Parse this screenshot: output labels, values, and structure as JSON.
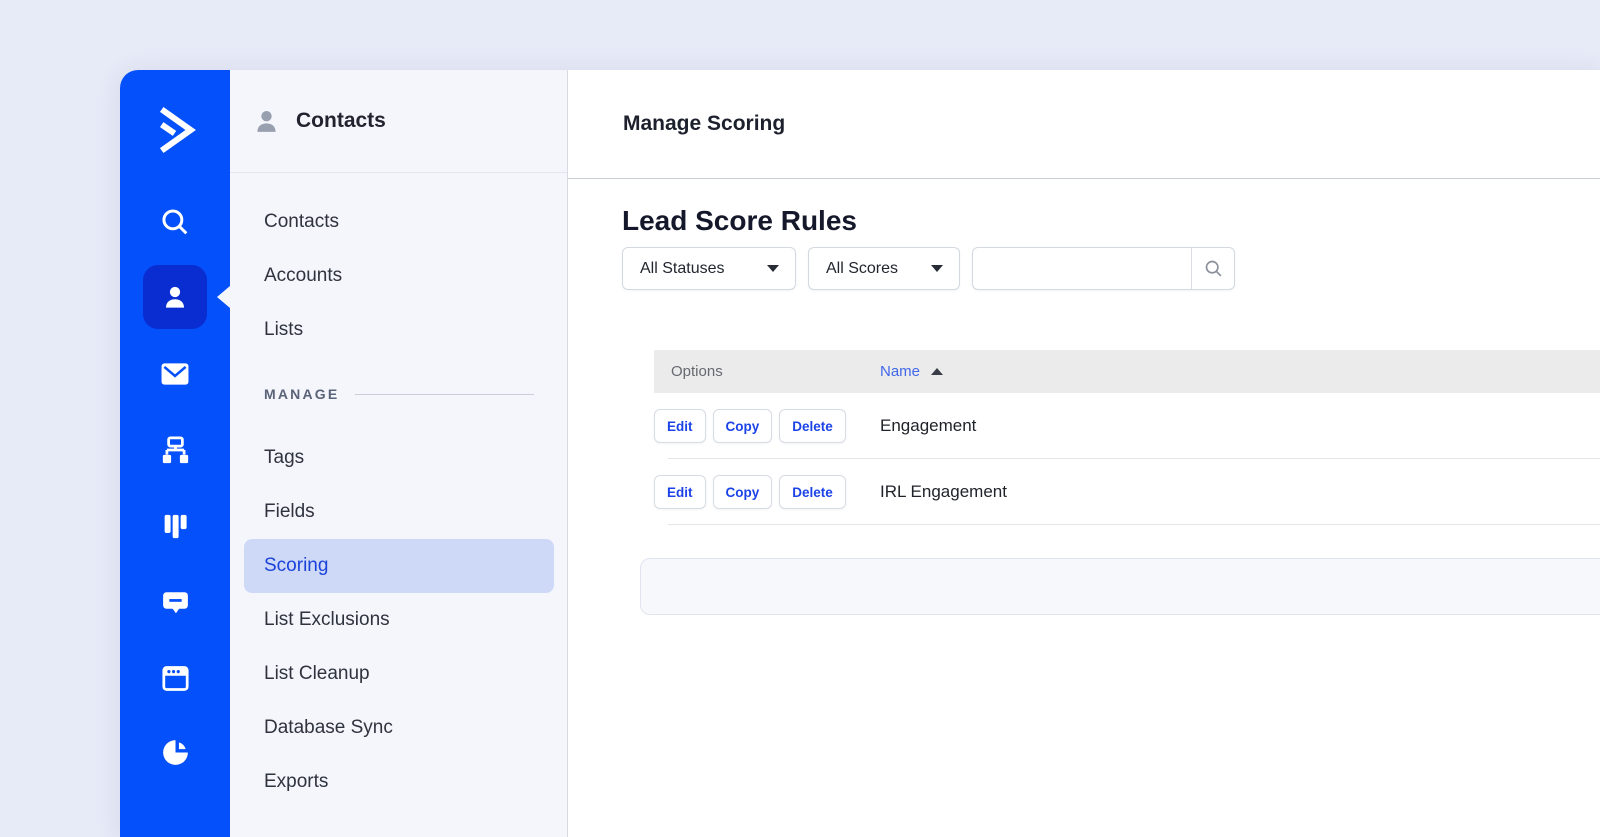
{
  "colors": {
    "page_bg": "#e7eaf7",
    "rail_blue": "#0450fb",
    "rail_active_blue": "#0a2dd2",
    "subnav_bg": "#f4f6fc",
    "active_pill_bg": "#cdd9f7",
    "active_pill_text": "#1b43db",
    "link_blue": "#4168e8",
    "button_text_blue": "#1c43e8",
    "table_header_bg": "#ebebec"
  },
  "rail": {
    "logo": "activecampaign-chevron-logo",
    "icons": [
      {
        "name": "search"
      },
      {
        "name": "contacts-person",
        "active": true
      },
      {
        "name": "campaigns-envelope"
      },
      {
        "name": "automations-sitemap"
      },
      {
        "name": "deals-kanban"
      },
      {
        "name": "conversations-chat"
      },
      {
        "name": "website-browser"
      },
      {
        "name": "reports-pie"
      }
    ]
  },
  "subnav": {
    "title": "Contacts",
    "items": [
      "Contacts",
      "Accounts",
      "Lists"
    ],
    "section_label": "MANAGE",
    "manage_items": [
      "Tags",
      "Fields",
      "Scoring",
      "List Exclusions",
      "List Cleanup",
      "Database Sync",
      "Exports"
    ],
    "active_item": "Scoring"
  },
  "main": {
    "header_title": "Manage Scoring",
    "page_title": "Lead Score Rules",
    "filters": {
      "status_dropdown": "All Statuses",
      "score_dropdown": "All Scores",
      "search_value": "",
      "search_placeholder": ""
    },
    "table": {
      "columns": {
        "options": "Options",
        "name": "Name"
      },
      "sort": {
        "column": "Name",
        "direction": "asc"
      },
      "row_actions": {
        "edit": "Edit",
        "copy": "Copy",
        "delete": "Delete"
      },
      "rows": [
        {
          "name": "Engagement"
        },
        {
          "name": "IRL Engagement"
        }
      ]
    }
  }
}
